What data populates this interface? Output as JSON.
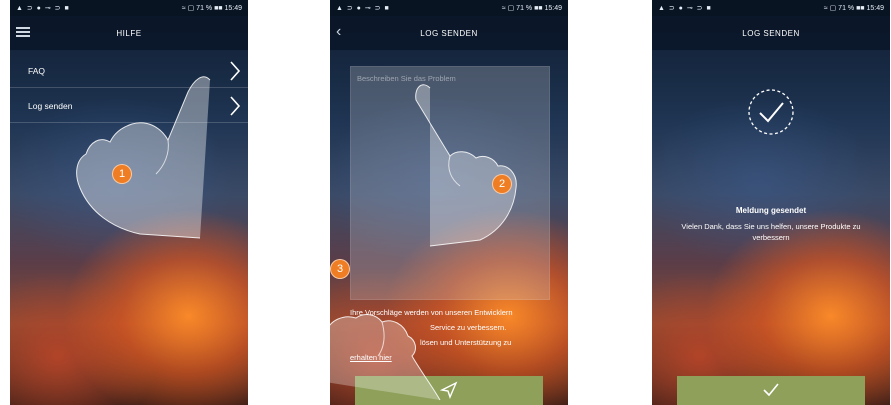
{
  "status_bar": {
    "icons": "▲ ⊃ ● ⊸ ⊃ ■",
    "right": "≈ ▢ 71 % ■■ 15:49"
  },
  "screen1": {
    "title": "HILFE",
    "menu": [
      {
        "label": "FAQ"
      },
      {
        "label": "Log senden"
      }
    ]
  },
  "screen2": {
    "title": "LOG SENDEN",
    "textarea_placeholder": "Beschreiben Sie das Problem",
    "info_lines": [
      "Ihre Vorschläge werden von unseren Entwicklern",
      "Service zu verbessern.",
      "lösen und Unterstützung zu",
      "erhalten hier"
    ]
  },
  "screen3": {
    "title": "LOG SENDEN",
    "message_title": "Meldung gesendet",
    "message_body": "Vielen Dank, dass Sie uns helfen, unsere Produkte zu verbessern"
  },
  "steps": [
    "1",
    "2",
    "3"
  ],
  "colors": {
    "accent_green": "#8ea05a",
    "badge_orange": "#ef7d23",
    "titlebar": "#0a1628"
  }
}
